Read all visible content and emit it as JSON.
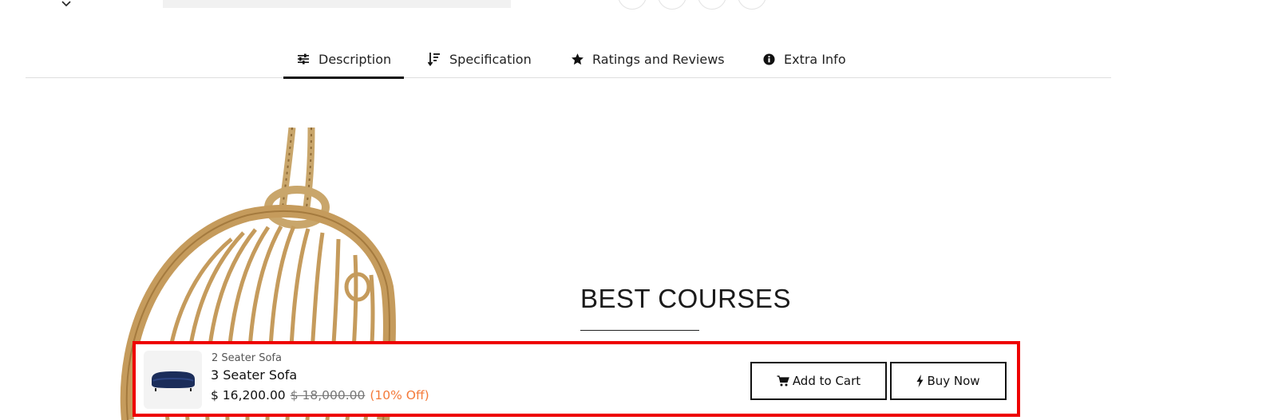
{
  "tabs": [
    {
      "label": "Description",
      "icon": "sliders-icon",
      "active": true
    },
    {
      "label": "Specification",
      "icon": "sort-icon",
      "active": false
    },
    {
      "label": "Ratings and Reviews",
      "icon": "star-icon",
      "active": false
    },
    {
      "label": "Extra Info",
      "icon": "info-icon",
      "active": false
    }
  ],
  "content": {
    "heading": "BEST COURSES"
  },
  "sticky": {
    "category": "2 Seater Sofa",
    "product_name": "3 Seater Sofa",
    "price": "$ 16,200.00",
    "original_price": "$ 18,000.00",
    "discount": "(10% Off)",
    "add_to_cart_label": "Add to Cart",
    "buy_now_label": "Buy Now"
  },
  "colors": {
    "highlight_border": "#ee0000",
    "discount": "#f47a3a",
    "tab_active_underline": "#111111"
  }
}
